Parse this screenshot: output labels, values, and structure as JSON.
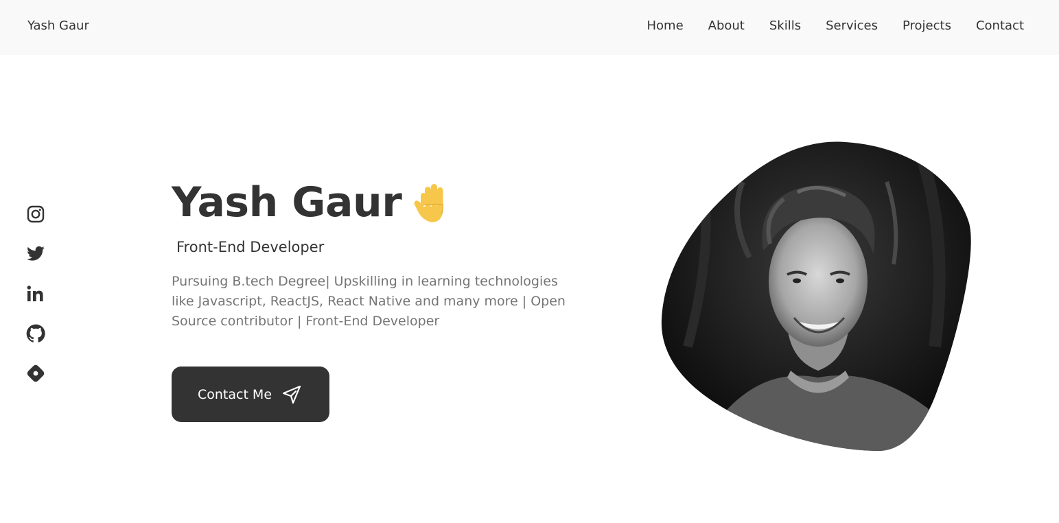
{
  "header": {
    "logo": "Yash Gaur",
    "nav": [
      "Home",
      "About",
      "Skills",
      "Services",
      "Projects",
      "Contact"
    ]
  },
  "social": {
    "icons": [
      "instagram-icon",
      "twitter-icon",
      "linkedin-icon",
      "github-icon",
      "hashnode-icon"
    ]
  },
  "hero": {
    "title": "Yash Gaur",
    "wave_icon": "waving-hand-icon",
    "subtitle": "Front-End Developer",
    "description": "Pursuing B.tech Degree| Upskilling in learning technologies like Javascript, ReactJS, React Native and many more | Open Source contributor | Front-End Developer",
    "button_label": "Contact Me",
    "button_icon": "send-icon"
  },
  "profile_image": {
    "icon": "profile-photo"
  },
  "colors": {
    "text_dark": "#333333",
    "text_muted": "#757575",
    "header_bg": "#f9f9f9",
    "button_bg": "#333333",
    "wave": "#f6c74a"
  }
}
